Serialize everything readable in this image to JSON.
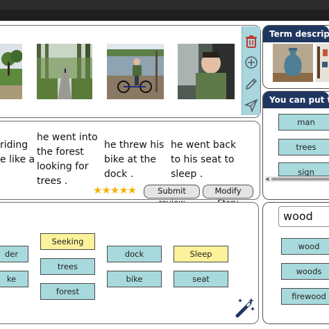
{
  "toolbar": {
    "icons": [
      "trash-icon",
      "add-circle-icon",
      "pencil-icon",
      "send-icon"
    ],
    "icon_color": "#c0392b",
    "tool_color": "#4a5a66"
  },
  "story": {
    "segments": [
      {
        "lines": [
          "riding",
          "e like a"
        ]
      },
      {
        "lines": [
          "he went into",
          "the forest",
          "looking for",
          "trees ."
        ]
      },
      {
        "lines": [
          "he threw his",
          "bike at the",
          "dock ."
        ]
      },
      {
        "lines": [
          "he went back",
          "to his seat to",
          "sleep ."
        ]
      }
    ],
    "rating": "★★★★★",
    "submit_review": "Submit review",
    "modify_story": "Modify Story"
  },
  "words": {
    "chips": [
      {
        "label": "der",
        "color": "blue"
      },
      {
        "label": "ke",
        "color": "blue"
      },
      {
        "label": "Seeking",
        "color": "yellow"
      },
      {
        "label": "trees",
        "color": "blue"
      },
      {
        "label": "forest",
        "color": "blue"
      },
      {
        "label": "dock",
        "color": "blue"
      },
      {
        "label": "bike",
        "color": "blue"
      },
      {
        "label": "Sleep",
        "color": "yellow"
      },
      {
        "label": "seat",
        "color": "blue"
      }
    ],
    "magic_icon": "magic-wand-icon"
  },
  "description": {
    "header": "Term descriptio"
  },
  "put": {
    "header": "You can put ter",
    "items": [
      "man",
      "trees",
      "sign"
    ]
  },
  "search": {
    "value": "wood",
    "results": [
      "wood",
      "woods",
      "firewood"
    ]
  },
  "colors": {
    "header_bg": "#1f3760",
    "chip_blue": "#a8dadd",
    "chip_yellow": "#fbf29b",
    "star": "#f2b400"
  }
}
